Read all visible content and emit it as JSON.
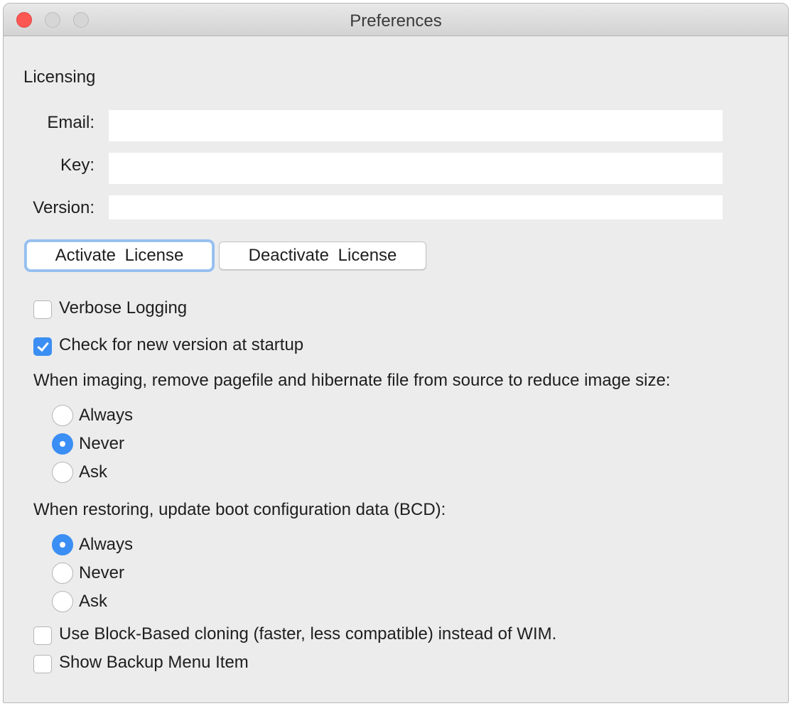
{
  "window": {
    "title": "Preferences"
  },
  "licensing": {
    "section_title": "Licensing",
    "email_label": "Email:",
    "email_value": "",
    "key_label": "Key:",
    "key_value": "",
    "version_label": "Version:",
    "version_value": "",
    "activate_label": "Activate  License",
    "deactivate_label": "Deactivate  License"
  },
  "options": {
    "verbose_logging": {
      "label": "Verbose Logging",
      "checked": false
    },
    "check_updates": {
      "label": "Check for new version at startup",
      "checked": true
    },
    "imaging": {
      "question": "When imaging, remove pagefile and hibernate file from source to reduce image size:",
      "options": [
        "Always",
        "Never",
        "Ask"
      ],
      "selected": "Never"
    },
    "restoring": {
      "question": "When restoring, update boot configuration data (BCD):",
      "options": [
        "Always",
        "Never",
        "Ask"
      ],
      "selected": "Always"
    },
    "block_based": {
      "label": "Use Block-Based cloning (faster, less compatible) instead of WIM.",
      "checked": false
    },
    "backup_menu": {
      "label": "Show Backup Menu Item",
      "checked": false
    }
  },
  "colors": {
    "accent": "#3b8ef3",
    "close": "#fc5753"
  }
}
